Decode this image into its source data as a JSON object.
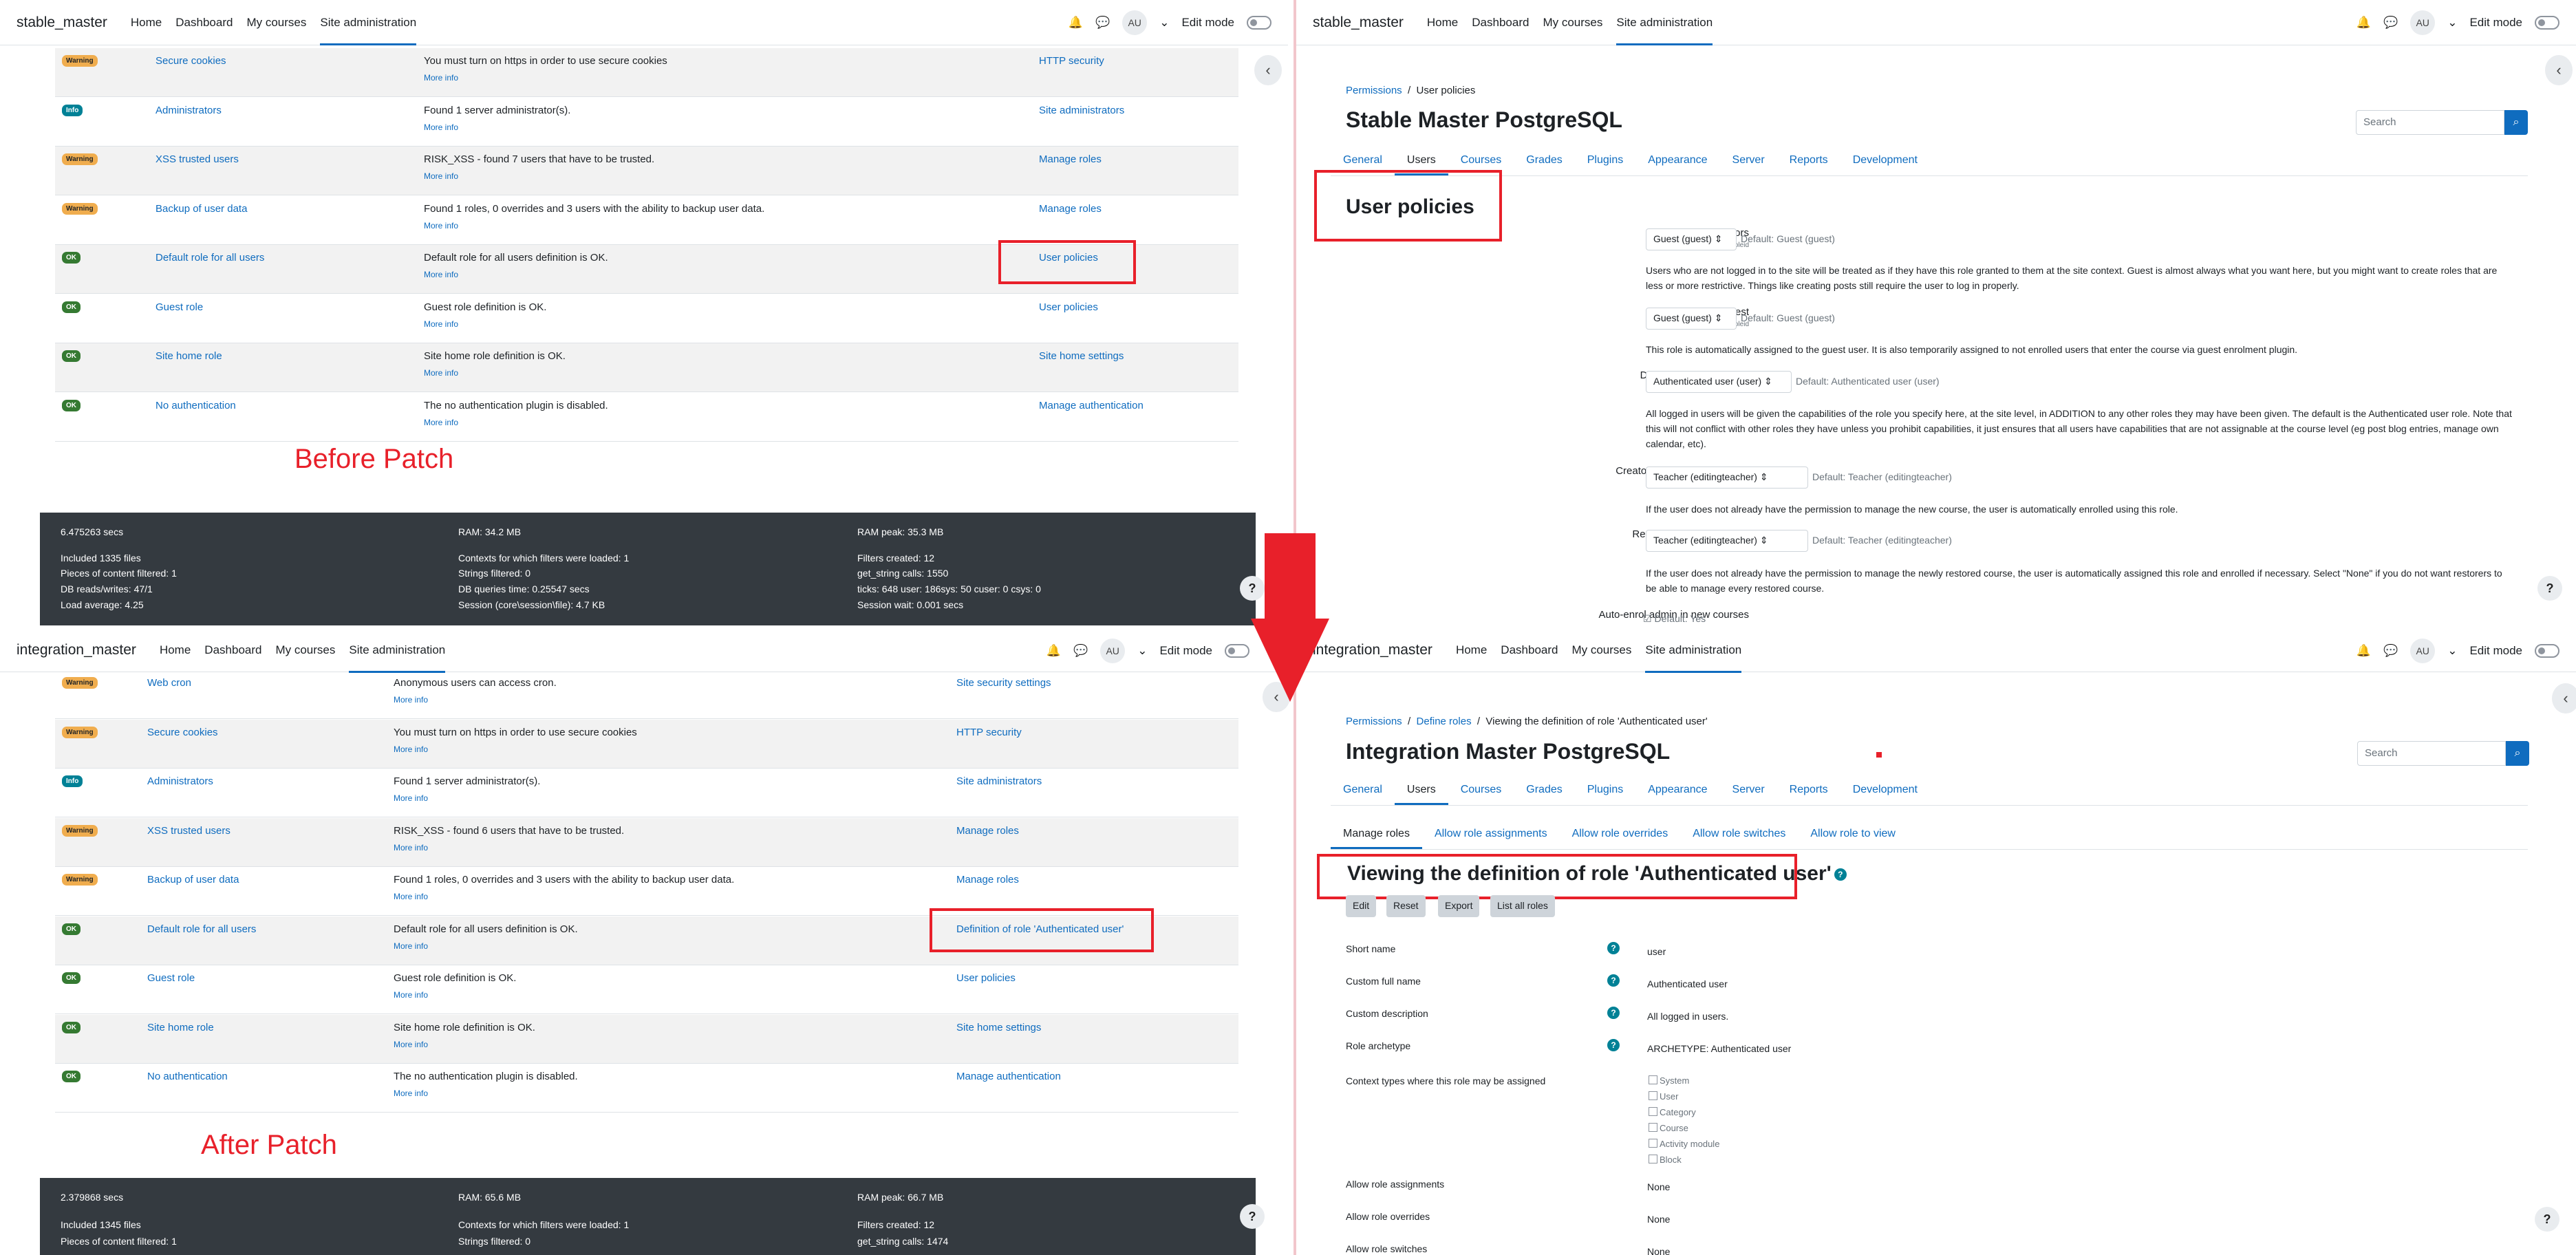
{
  "panel1": {
    "brand": "stable_master",
    "label": "Before Patch",
    "rows": [
      {
        "badge": "Warning",
        "name": "Secure cookies",
        "desc": "You must turn on https in order to use secure cookies",
        "action": "HTTP security"
      },
      {
        "badge": "Info",
        "name": "Administrators",
        "desc": "Found 1 server administrator(s).",
        "action": "Site administrators"
      },
      {
        "badge": "Warning",
        "name": "XSS trusted users",
        "desc": "RISK_XSS - found 7 users that have to be trusted.",
        "action": "Manage roles"
      },
      {
        "badge": "Warning",
        "name": "Backup of user data",
        "desc": "Found 1 roles, 0 overrides and 3 users with the ability to backup user data.",
        "action": "Manage roles"
      },
      {
        "badge": "OK",
        "name": "Default role for all users",
        "desc": "Default role for all users definition is OK.",
        "action": "User policies"
      },
      {
        "badge": "OK",
        "name": "Guest role",
        "desc": "Guest role definition is OK.",
        "action": "User policies"
      },
      {
        "badge": "OK",
        "name": "Site home role",
        "desc": "Site home role definition is OK.",
        "action": "Site home settings"
      },
      {
        "badge": "OK",
        "name": "No authentication",
        "desc": "The no authentication plugin is disabled.",
        "action": "Manage authentication"
      }
    ],
    "footer": {
      "time": "6.475263 secs",
      "ram": "RAM: 34.2 MB",
      "ram_peak": "RAM peak: 35.3 MB",
      "files": "Included 1335 files",
      "contexts": "Contexts for which filters were loaded: 1",
      "filters_created": "Filters created: 12",
      "content": "Pieces of content filtered: 1",
      "strings": "Strings filtered: 0",
      "get_string": "get_string calls: 1550",
      "db": "DB reads/writes: 47/1",
      "dbtime": "DB queries time: 0.25547 secs",
      "ticks": "ticks: 648 user: 186sys: 50 cuser: 0 csys: 0",
      "load": "Load average: 4.25",
      "session": "Session (core\\session\\file): 4.7 KB",
      "session_wait": "Session wait: 0.001 secs"
    }
  },
  "panel3": {
    "brand": "integration_master",
    "label": "After Patch",
    "rows": [
      {
        "badge": "Warning",
        "name": "Web cron",
        "desc": "Anonymous users can access cron.",
        "action": "Site security settings"
      },
      {
        "badge": "Warning",
        "name": "Secure cookies",
        "desc": "You must turn on https in order to use secure cookies",
        "action": "HTTP security"
      },
      {
        "badge": "Info",
        "name": "Administrators",
        "desc": "Found 1 server administrator(s).",
        "action": "Site administrators"
      },
      {
        "badge": "Warning",
        "name": "XSS trusted users",
        "desc": "RISK_XSS - found 6 users that have to be trusted.",
        "action": "Manage roles"
      },
      {
        "badge": "Warning",
        "name": "Backup of user data",
        "desc": "Found 1 roles, 0 overrides and 3 users with the ability to backup user data.",
        "action": "Manage roles"
      },
      {
        "badge": "OK",
        "name": "Default role for all users",
        "desc": "Default role for all users definition is OK.",
        "action": "Definition of role 'Authenticated user'"
      },
      {
        "badge": "OK",
        "name": "Guest role",
        "desc": "Guest role definition is OK.",
        "action": "User policies"
      },
      {
        "badge": "OK",
        "name": "Site home role",
        "desc": "Site home role definition is OK.",
        "action": "Site home settings"
      },
      {
        "badge": "OK",
        "name": "No authentication",
        "desc": "The no authentication plugin is disabled.",
        "action": "Manage authentication"
      }
    ],
    "footer": {
      "time": "2.379868 secs",
      "ram": "RAM: 65.6 MB",
      "ram_peak": "RAM peak: 66.7 MB",
      "files": "Included 1345 files",
      "contexts": "Contexts for which filters were loaded: 1",
      "filters_created": "Filters created: 12",
      "content": "Pieces of content filtered: 1",
      "strings": "Strings filtered: 0",
      "get_string": "get_string calls: 1474"
    }
  },
  "more_info": "More info",
  "nav": {
    "home": "Home",
    "dashboard": "Dashboard",
    "my_courses": "My courses",
    "site_admin": "Site administration",
    "avatar": "AU",
    "edit_mode": "Edit mode"
  },
  "panel2": {
    "brand": "stable_master",
    "breadcrumb_1": "Permissions",
    "breadcrumb_2": "User policies",
    "site_title": "Stable Master PostgreSQL",
    "search_placeholder": "Search",
    "tabs": [
      "General",
      "Users",
      "Courses",
      "Grades",
      "Plugins",
      "Appearance",
      "Server",
      "Reports",
      "Development"
    ],
    "heading": "User policies",
    "settings": [
      {
        "label": "Role for visitors",
        "key": "notloggedinroleid",
        "value": "Guest (guest)",
        "default": "Default: Guest (guest)",
        "desc": "Users who are not logged in to the site will be treated as if they have this role granted to them at the site context. Guest is almost always what you want here, but you might want to create roles that are less or more restrictive. Things like creating posts still require the user to log in properly."
      },
      {
        "label": "Role for guest",
        "key": "guestroleid",
        "value": "Guest (guest)",
        "default": "Default: Guest (guest)",
        "desc": "This role is automatically assigned to the guest user. It is also temporarily assigned to not enrolled users that enter the course via guest enrolment plugin."
      },
      {
        "label": "Default role for all users",
        "key": "defaultuserroleid",
        "value": "Authenticated user (user)",
        "default": "Default: Authenticated user (user)",
        "desc": "All logged in users will be given the capabilities of the role you specify here, at the site level, in ADDITION to any other roles they may have been given. The default is the Authenticated user role. Note that this will not conflict with other roles they have unless you prohibit capabilities, it just ensures that all users have capabilities that are not assignable at the course level (eg post blog entries, manage own calendar, etc)."
      },
      {
        "label": "Creators' role in new courses",
        "key": "creatornewroleid",
        "value": "Teacher (editingteacher)",
        "default": "Default: Teacher (editingteacher)",
        "desc": "If the user does not already have the permission to manage the new course, the user is automatically enrolled using this role."
      },
      {
        "label": "Restorers' role in courses",
        "key": "restorernewroleid",
        "value": "Teacher (editingteacher)",
        "default": "Default: Teacher (editingteacher)",
        "desc": "If the user does not already have the permission to manage the newly restored course, the user is automatically assigned this role and enrolled if necessary. Select \"None\" if you do not want restorers to be able to manage every restored course."
      }
    ],
    "last_label": "Auto-enrol admin in new courses",
    "last_default": "Default: Yes"
  },
  "panel4": {
    "brand": "integration_master",
    "breadcrumb_1": "Permissions",
    "breadcrumb_2": "Define roles",
    "breadcrumb_3": "Viewing the definition of role 'Authenticated user'",
    "site_title": "Integration Master PostgreSQL",
    "search_placeholder": "Search",
    "tabs": [
      "General",
      "Users",
      "Courses",
      "Grades",
      "Plugins",
      "Appearance",
      "Server",
      "Reports",
      "Development"
    ],
    "subtabs": [
      "Manage roles",
      "Allow role assignments",
      "Allow role overrides",
      "Allow role switches",
      "Allow role to view"
    ],
    "heading": "Viewing the definition of role 'Authenticated user'",
    "buttons": [
      "Edit",
      "Reset",
      "Export",
      "List all roles"
    ],
    "fields": [
      {
        "label": "Short name",
        "value": "user"
      },
      {
        "label": "Custom full name",
        "value": "Authenticated user"
      },
      {
        "label": "Custom description",
        "value": "All logged in users."
      },
      {
        "label": "Role archetype",
        "value": "ARCHETYPE: Authenticated user"
      }
    ],
    "context_label": "Context types where this role may be assigned",
    "contexts": [
      "System",
      "User",
      "Category",
      "Course",
      "Activity module",
      "Block"
    ],
    "allow": [
      {
        "label": "Allow role assignments",
        "value": "None"
      },
      {
        "label": "Allow role overrides",
        "value": "None"
      },
      {
        "label": "Allow role switches",
        "value": "None"
      }
    ]
  },
  "colors": {
    "link": "#0f6cbf",
    "annotation": "#e8202a",
    "footer_bg": "#343a40",
    "warning": "#f0ad4e",
    "info": "#008196",
    "ok": "#357a32"
  }
}
